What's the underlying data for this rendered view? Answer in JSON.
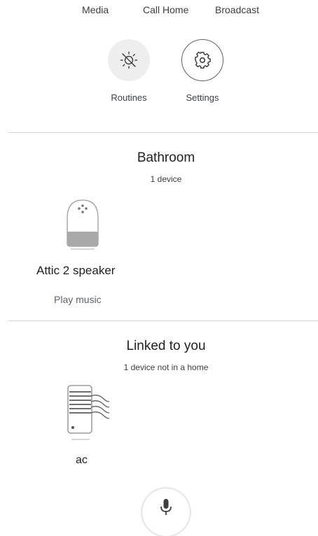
{
  "top_actions": {
    "media": "Media",
    "call_home": "Call Home",
    "broadcast": "Broadcast"
  },
  "quick_buttons": {
    "routines": {
      "label": "Routines",
      "icon": "routines-sun-icon"
    },
    "settings": {
      "label": "Settings",
      "icon": "gear-icon"
    }
  },
  "rooms": [
    {
      "name": "Bathroom",
      "subtitle": "1 device",
      "devices": [
        {
          "name": "Attic 2 speaker",
          "action": "Play music",
          "icon": "smart-speaker-icon"
        }
      ]
    }
  ],
  "linked": {
    "title": "Linked to you",
    "subtitle": "1 device not in a home",
    "devices": [
      {
        "name": "ac",
        "icon": "air-conditioner-icon"
      }
    ]
  },
  "mic_button": {
    "icon": "microphone-icon"
  },
  "colors": {
    "background": "#ffffff",
    "text_primary": "#202124",
    "text_secondary": "#5f6368",
    "routines_bg": "#eeeeee",
    "divider": "#d6d6d6"
  }
}
